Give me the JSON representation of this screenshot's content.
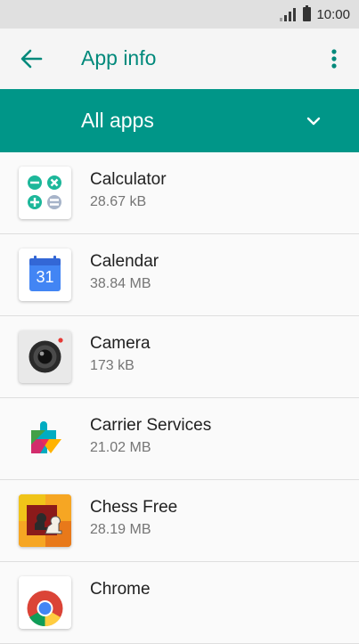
{
  "status_bar": {
    "time": "10:00",
    "signal_icon": "cell-signal-icon",
    "battery_icon": "battery-icon"
  },
  "toolbar": {
    "title": "App info",
    "back_icon": "arrow-back-icon",
    "menu_icon": "more-vert-icon"
  },
  "filter": {
    "selected": "All apps",
    "dropdown_icon": "chevron-down-icon"
  },
  "apps": [
    {
      "name": "Calculator",
      "size": "28.67 kB",
      "icon": "calculator-icon"
    },
    {
      "name": "Calendar",
      "size": "38.84 MB",
      "icon": "calendar-icon",
      "icon_text": "31"
    },
    {
      "name": "Camera",
      "size": "173 kB",
      "icon": "camera-icon"
    },
    {
      "name": "Carrier Services",
      "size": "21.02 MB",
      "icon": "carrier-services-icon"
    },
    {
      "name": "Chess Free",
      "size": "28.19 MB",
      "icon": "chess-icon"
    },
    {
      "name": "Chrome",
      "size": "",
      "icon": "chrome-icon"
    }
  ],
  "colors": {
    "accent": "#009688",
    "accent_dark_text": "#00897b",
    "status_bar": "#e0e0e0"
  }
}
